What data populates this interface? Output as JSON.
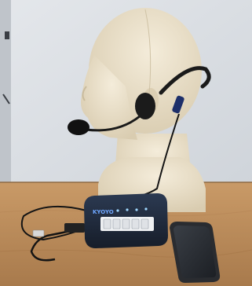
{
  "device": {
    "brand": "KYOYO"
  },
  "colors": {
    "wall": "#d9dde2",
    "table": "#b98a5a",
    "mannequin": "#e9dfc9",
    "device_body": "#1f2a3a",
    "device_panel": "#eef0f2",
    "phone": "#2a2c30"
  }
}
